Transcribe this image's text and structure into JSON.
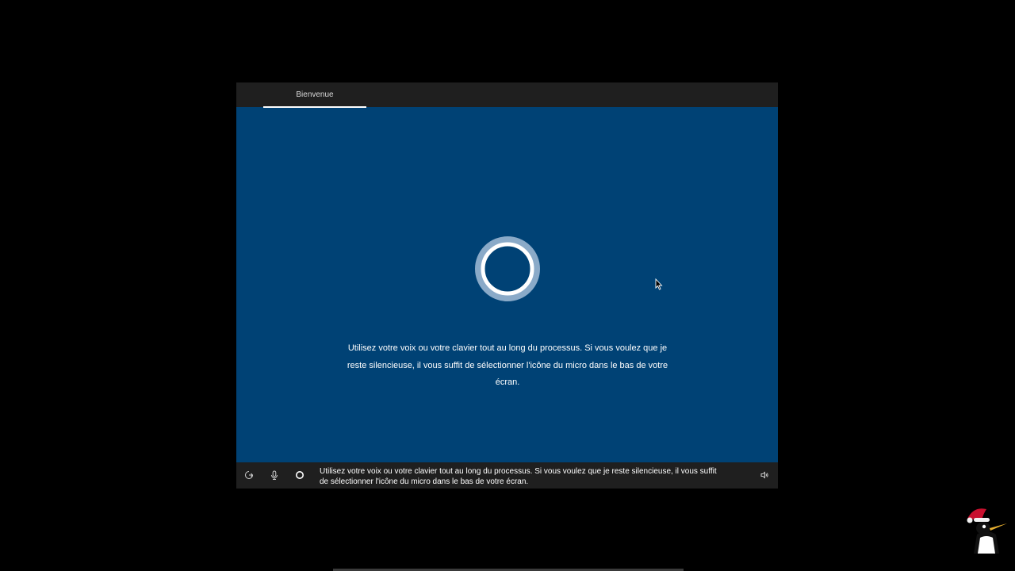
{
  "tabs": [
    {
      "label": "Bienvenue",
      "active": true
    }
  ],
  "main": {
    "message_line1": "Utilisez votre voix ou votre clavier tout au long du processus. Si vous voulez que je",
    "message_line2": "reste silencieuse, il vous suffit de sélectionner l'icône du micro dans le bas de votre",
    "message_line3": "écran."
  },
  "bottom_bar": {
    "caption_line1": "Utilisez votre voix ou votre clavier tout au long du processus. Si vous voulez que je reste silencieuse, il vous suffit",
    "caption_line2": "de sélectionner l'icône du micro dans le bas de votre écran.",
    "icons": [
      "accessibility-icon",
      "microphone-icon",
      "cortana-icon",
      "volume-icon"
    ]
  },
  "colors": {
    "window_bg": "#004275",
    "bar_bg": "#1f1f1f",
    "page_bg": "#000000",
    "text": "#ffffff"
  }
}
